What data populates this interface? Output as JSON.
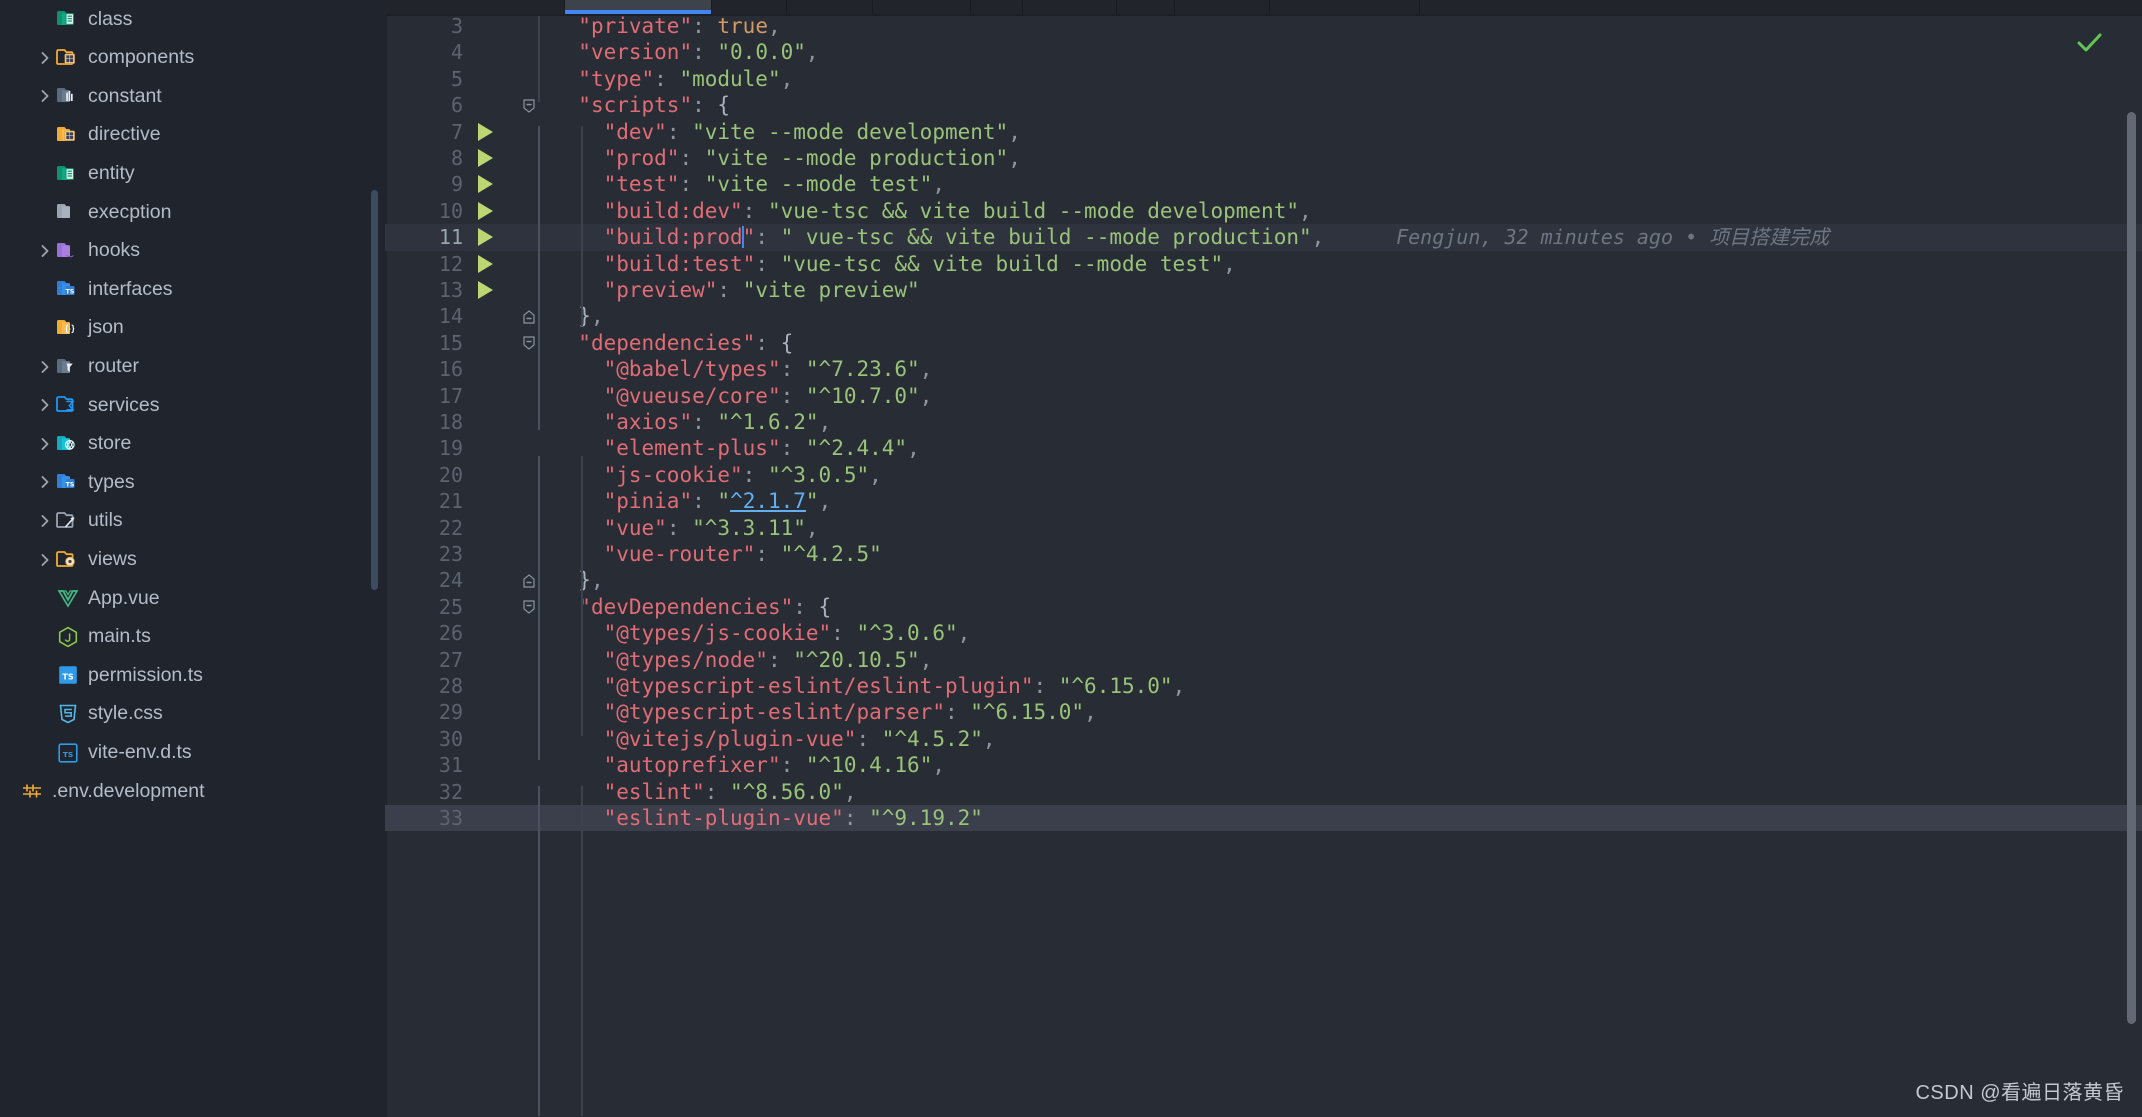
{
  "theme": {
    "sidebar_bg": "#20242c",
    "editor_bg": "#282c34",
    "tab_accent": "#4286f4",
    "key_color": "#e06c75",
    "string_color": "#98c379",
    "boolean_color": "#d19a66",
    "linenum_color": "#5c636e",
    "run_arrow_color": "#bcd674",
    "link_color": "#61afef",
    "blame_color": "#6d7582"
  },
  "sidebar": {
    "items": [
      {
        "label": "class",
        "icon": "folder-class-icon",
        "indent": 2,
        "expandable": false,
        "expanded": false
      },
      {
        "label": "components",
        "icon": "folder-components-icon",
        "indent": 2,
        "expandable": true,
        "expanded": false
      },
      {
        "label": "constant",
        "icon": "folder-constant-icon",
        "indent": 2,
        "expandable": true,
        "expanded": false
      },
      {
        "label": "directive",
        "icon": "folder-directive-icon",
        "indent": 2,
        "expandable": false,
        "expanded": false
      },
      {
        "label": "entity",
        "icon": "folder-entity-icon",
        "indent": 2,
        "expandable": false,
        "expanded": false
      },
      {
        "label": "execption",
        "icon": "folder-plain-icon",
        "indent": 2,
        "expandable": false,
        "expanded": false
      },
      {
        "label": "hooks",
        "icon": "folder-hooks-icon",
        "indent": 2,
        "expandable": true,
        "expanded": false
      },
      {
        "label": "interfaces",
        "icon": "folder-ts-icon",
        "indent": 2,
        "expandable": false,
        "expanded": false
      },
      {
        "label": "json",
        "icon": "folder-json-icon",
        "indent": 2,
        "expandable": false,
        "expanded": false
      },
      {
        "label": "router",
        "icon": "folder-router-icon",
        "indent": 2,
        "expandable": true,
        "expanded": false
      },
      {
        "label": "services",
        "icon": "folder-services-icon",
        "indent": 2,
        "expandable": true,
        "expanded": false
      },
      {
        "label": "store",
        "icon": "folder-store-icon",
        "indent": 2,
        "expandable": true,
        "expanded": false
      },
      {
        "label": "types",
        "icon": "folder-ts-icon",
        "indent": 2,
        "expandable": true,
        "expanded": false
      },
      {
        "label": "utils",
        "icon": "folder-utils-icon",
        "indent": 2,
        "expandable": true,
        "expanded": false
      },
      {
        "label": "views",
        "icon": "folder-views-icon",
        "indent": 2,
        "expandable": true,
        "expanded": false
      },
      {
        "label": "App.vue",
        "icon": "vue-file-icon",
        "indent": 2,
        "expandable": false,
        "expanded": false
      },
      {
        "label": "main.ts",
        "icon": "js-node-file-icon",
        "indent": 2,
        "expandable": false,
        "expanded": false
      },
      {
        "label": "permission.ts",
        "icon": "ts-file-icon",
        "indent": 2,
        "expandable": false,
        "expanded": false
      },
      {
        "label": "style.css",
        "icon": "css-file-icon",
        "indent": 2,
        "expandable": false,
        "expanded": false
      },
      {
        "label": "vite-env.d.ts",
        "icon": "ts-declaration-icon",
        "indent": 2,
        "expandable": false,
        "expanded": false
      },
      {
        "label": ".env.development",
        "icon": "env-settings-icon",
        "indent": 1,
        "expandable": false,
        "expanded": false
      }
    ]
  },
  "editor": {
    "first_line_number": 3,
    "current_line": 11,
    "blame": {
      "line": 11,
      "text": "Fengjun, 32 minutes ago • 项目搭建完成"
    },
    "inspection_status": "ok-check-icon",
    "lines": [
      {
        "n": 3,
        "indent": 1,
        "tokens": [
          {
            "t": "k",
            "v": "\"private\""
          },
          {
            "t": "p",
            "v": ": "
          },
          {
            "t": "b",
            "v": "true"
          },
          {
            "t": "p",
            "v": ","
          }
        ]
      },
      {
        "n": 4,
        "indent": 1,
        "tokens": [
          {
            "t": "k",
            "v": "\"version\""
          },
          {
            "t": "p",
            "v": ": "
          },
          {
            "t": "s",
            "v": "\"0.0.0\""
          },
          {
            "t": "p",
            "v": ","
          }
        ]
      },
      {
        "n": 5,
        "indent": 1,
        "tokens": [
          {
            "t": "k",
            "v": "\"type\""
          },
          {
            "t": "p",
            "v": ": "
          },
          {
            "t": "s",
            "v": "\"module\""
          },
          {
            "t": "p",
            "v": ","
          }
        ]
      },
      {
        "n": 6,
        "indent": 1,
        "fold": "open",
        "tokens": [
          {
            "t": "k",
            "v": "\"scripts\""
          },
          {
            "t": "p",
            "v": ": "
          },
          {
            "t": "br",
            "v": "{"
          }
        ]
      },
      {
        "n": 7,
        "indent": 2,
        "run": true,
        "tokens": [
          {
            "t": "k",
            "v": "\"dev\""
          },
          {
            "t": "p",
            "v": ": "
          },
          {
            "t": "s",
            "v": "\"vite --mode development\""
          },
          {
            "t": "p",
            "v": ","
          }
        ]
      },
      {
        "n": 8,
        "indent": 2,
        "run": true,
        "tokens": [
          {
            "t": "k",
            "v": "\"prod\""
          },
          {
            "t": "p",
            "v": ": "
          },
          {
            "t": "s",
            "v": "\"vite --mode production\""
          },
          {
            "t": "p",
            "v": ","
          }
        ]
      },
      {
        "n": 9,
        "indent": 2,
        "run": true,
        "tokens": [
          {
            "t": "k",
            "v": "\"test\""
          },
          {
            "t": "p",
            "v": ": "
          },
          {
            "t": "s",
            "v": "\"vite --mode test\""
          },
          {
            "t": "p",
            "v": ","
          }
        ]
      },
      {
        "n": 10,
        "indent": 2,
        "run": true,
        "tokens": [
          {
            "t": "k",
            "v": "\"build:dev\""
          },
          {
            "t": "p",
            "v": ": "
          },
          {
            "t": "s",
            "v": "\"vue-tsc && vite build --mode development\""
          },
          {
            "t": "p",
            "v": ","
          }
        ]
      },
      {
        "n": 11,
        "indent": 2,
        "run": true,
        "current": true,
        "tokens": [
          {
            "t": "k",
            "v": "\"build:prod"
          },
          {
            "t": "caret",
            "v": ""
          },
          {
            "t": "k",
            "v": "\""
          },
          {
            "t": "p",
            "v": ": "
          },
          {
            "t": "s",
            "v": "\" vue-tsc && vite build --mode production\""
          },
          {
            "t": "p",
            "v": ","
          }
        ]
      },
      {
        "n": 12,
        "indent": 2,
        "run": true,
        "tokens": [
          {
            "t": "k",
            "v": "\"build:test\""
          },
          {
            "t": "p",
            "v": ": "
          },
          {
            "t": "s",
            "v": "\"vue-tsc && vite build --mode test\""
          },
          {
            "t": "p",
            "v": ","
          }
        ]
      },
      {
        "n": 13,
        "indent": 2,
        "run": true,
        "tokens": [
          {
            "t": "k",
            "v": "\"preview\""
          },
          {
            "t": "p",
            "v": ": "
          },
          {
            "t": "s",
            "v": "\"vite preview\""
          }
        ]
      },
      {
        "n": 14,
        "indent": 1,
        "fold": "close",
        "tokens": [
          {
            "t": "br",
            "v": "}"
          },
          {
            "t": "p",
            "v": ","
          }
        ]
      },
      {
        "n": 15,
        "indent": 1,
        "fold": "open",
        "tokens": [
          {
            "t": "k",
            "v": "\"dependencies\""
          },
          {
            "t": "p",
            "v": ": "
          },
          {
            "t": "br",
            "v": "{"
          }
        ]
      },
      {
        "n": 16,
        "indent": 2,
        "tokens": [
          {
            "t": "k",
            "v": "\"@babel/types\""
          },
          {
            "t": "p",
            "v": ": "
          },
          {
            "t": "s",
            "v": "\"^7.23.6\""
          },
          {
            "t": "p",
            "v": ","
          }
        ]
      },
      {
        "n": 17,
        "indent": 2,
        "tokens": [
          {
            "t": "k",
            "v": "\"@vueuse/core\""
          },
          {
            "t": "p",
            "v": ": "
          },
          {
            "t": "s",
            "v": "\"^10.7.0\""
          },
          {
            "t": "p",
            "v": ","
          }
        ]
      },
      {
        "n": 18,
        "indent": 2,
        "tokens": [
          {
            "t": "k",
            "v": "\"axios\""
          },
          {
            "t": "p",
            "v": ": "
          },
          {
            "t": "s",
            "v": "\"^1.6.2\""
          },
          {
            "t": "p",
            "v": ","
          }
        ]
      },
      {
        "n": 19,
        "indent": 2,
        "tokens": [
          {
            "t": "k",
            "v": "\"element-plus\""
          },
          {
            "t": "p",
            "v": ": "
          },
          {
            "t": "s",
            "v": "\"^2.4.4\""
          },
          {
            "t": "p",
            "v": ","
          }
        ]
      },
      {
        "n": 20,
        "indent": 2,
        "tokens": [
          {
            "t": "k",
            "v": "\"js-cookie\""
          },
          {
            "t": "p",
            "v": ": "
          },
          {
            "t": "s",
            "v": "\"^3.0.5\""
          },
          {
            "t": "p",
            "v": ","
          }
        ]
      },
      {
        "n": 21,
        "indent": 2,
        "tokens": [
          {
            "t": "k",
            "v": "\"pinia\""
          },
          {
            "t": "p",
            "v": ": "
          },
          {
            "t": "s",
            "v": "\""
          },
          {
            "t": "lnk",
            "v": "^2.1.7"
          },
          {
            "t": "s",
            "v": "\""
          },
          {
            "t": "p",
            "v": ","
          }
        ]
      },
      {
        "n": 22,
        "indent": 2,
        "tokens": [
          {
            "t": "k",
            "v": "\"vue\""
          },
          {
            "t": "p",
            "v": ": "
          },
          {
            "t": "s",
            "v": "\"^3.3.11\""
          },
          {
            "t": "p",
            "v": ","
          }
        ]
      },
      {
        "n": 23,
        "indent": 2,
        "tokens": [
          {
            "t": "k",
            "v": "\"vue-router\""
          },
          {
            "t": "p",
            "v": ": "
          },
          {
            "t": "s",
            "v": "\"^4.2.5\""
          }
        ]
      },
      {
        "n": 24,
        "indent": 1,
        "fold": "close",
        "tokens": [
          {
            "t": "br",
            "v": "}"
          },
          {
            "t": "p",
            "v": ","
          }
        ]
      },
      {
        "n": 25,
        "indent": 1,
        "fold": "open",
        "tokens": [
          {
            "t": "k",
            "v": "\"devDependencies\""
          },
          {
            "t": "p",
            "v": ": "
          },
          {
            "t": "br",
            "v": "{"
          }
        ]
      },
      {
        "n": 26,
        "indent": 2,
        "tokens": [
          {
            "t": "k",
            "v": "\"@types/js-cookie\""
          },
          {
            "t": "p",
            "v": ": "
          },
          {
            "t": "s",
            "v": "\"^3.0.6\""
          },
          {
            "t": "p",
            "v": ","
          }
        ]
      },
      {
        "n": 27,
        "indent": 2,
        "tokens": [
          {
            "t": "k",
            "v": "\"@types/node\""
          },
          {
            "t": "p",
            "v": ": "
          },
          {
            "t": "s",
            "v": "\"^20.10.5\""
          },
          {
            "t": "p",
            "v": ","
          }
        ]
      },
      {
        "n": 28,
        "indent": 2,
        "tokens": [
          {
            "t": "k",
            "v": "\"@typescript-eslint/eslint-plugin\""
          },
          {
            "t": "p",
            "v": ": "
          },
          {
            "t": "s",
            "v": "\"^6.15.0\""
          },
          {
            "t": "p",
            "v": ","
          }
        ]
      },
      {
        "n": 29,
        "indent": 2,
        "tokens": [
          {
            "t": "k",
            "v": "\"@typescript-eslint/parser\""
          },
          {
            "t": "p",
            "v": ": "
          },
          {
            "t": "s",
            "v": "\"^6.15.0\""
          },
          {
            "t": "p",
            "v": ","
          }
        ]
      },
      {
        "n": 30,
        "indent": 2,
        "tokens": [
          {
            "t": "k",
            "v": "\"@vitejs/plugin-vue\""
          },
          {
            "t": "p",
            "v": ": "
          },
          {
            "t": "s",
            "v": "\"^4.5.2\""
          },
          {
            "t": "p",
            "v": ","
          }
        ]
      },
      {
        "n": 31,
        "indent": 2,
        "tokens": [
          {
            "t": "k",
            "v": "\"autoprefixer\""
          },
          {
            "t": "p",
            "v": ": "
          },
          {
            "t": "s",
            "v": "\"^10.4.16\""
          },
          {
            "t": "p",
            "v": ","
          }
        ]
      },
      {
        "n": 32,
        "indent": 2,
        "tokens": [
          {
            "t": "k",
            "v": "\"eslint\""
          },
          {
            "t": "p",
            "v": ": "
          },
          {
            "t": "s",
            "v": "\"^8.56.0\""
          },
          {
            "t": "p",
            "v": ","
          }
        ]
      },
      {
        "n": 33,
        "indent": 2,
        "selected": true,
        "tokens": [
          {
            "t": "k",
            "v": "\"eslint-plugin-vue\""
          },
          {
            "t": "p",
            "v": ": "
          },
          {
            "t": "s",
            "v": "\"^9.19.2\""
          }
        ]
      }
    ]
  },
  "watermark": {
    "text": "CSDN @看遍日落黄昏"
  }
}
